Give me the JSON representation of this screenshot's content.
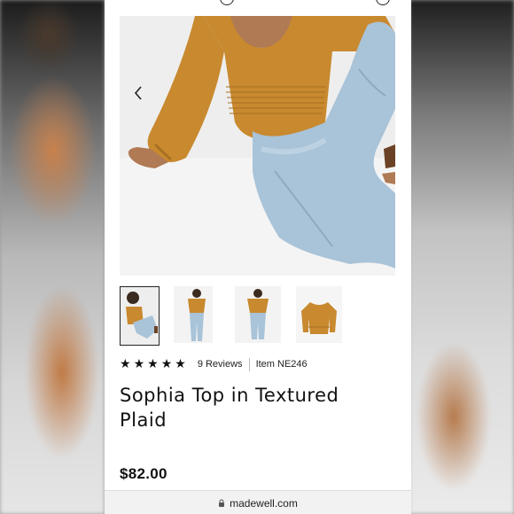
{
  "product": {
    "title": "Sophia Top in Textured Plaid",
    "price": "$82.00",
    "reviews": "9 Reviews",
    "item_number": "Item NE246",
    "rating_stars": 5,
    "rating_max": 5
  },
  "gallery": {
    "thumbnails": [
      {
        "name": "thumb-seated-pose",
        "selected": true
      },
      {
        "name": "thumb-standing-front",
        "selected": false
      },
      {
        "name": "thumb-standing-back",
        "selected": false
      },
      {
        "name": "thumb-top-flat",
        "selected": false
      }
    ]
  },
  "browser": {
    "url": "madewell.com"
  },
  "icons": {
    "prev": "chevron-left-icon",
    "next": "chevron-right-icon",
    "lock": "lock-icon",
    "star": "star-icon"
  },
  "colors": {
    "top": "#c8892f",
    "denim": "#a9c3d8",
    "text": "#111111"
  }
}
